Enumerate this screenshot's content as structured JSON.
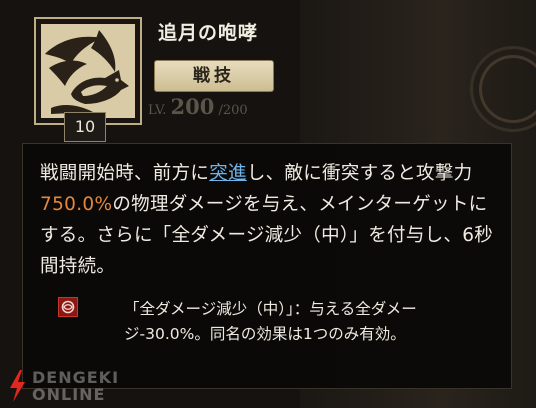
{
  "skill": {
    "name": "追月の咆哮",
    "type_label": "戦技",
    "level": "10"
  },
  "background": {
    "level_prefix": "LV.",
    "level_value": "200",
    "level_max": "/200"
  },
  "description": {
    "part1": "戦闘開始時、前方に",
    "keyword": "突進",
    "part2": "し、敵に衝突すると攻撃力",
    "damage_percent": "750.0%",
    "part3": "の物理ダメージを与え、メインターゲットにする。さらに「全ダメージ減少（中）」を付与し、6秒間持続。"
  },
  "effect": {
    "icon": "damage-reduction-icon",
    "text": "「全ダメージ減少（中）」：与える全ダメージ-30.0%。同名の効果は1つのみ有効。"
  },
  "watermark": {
    "line1": "DENGEKI",
    "line2": "ONLINE"
  },
  "colors": {
    "keyword": "#6fb3e8",
    "highlight": "#e5873a",
    "icon_frame": "#bfae85",
    "effect_icon": "#8c1712"
  }
}
